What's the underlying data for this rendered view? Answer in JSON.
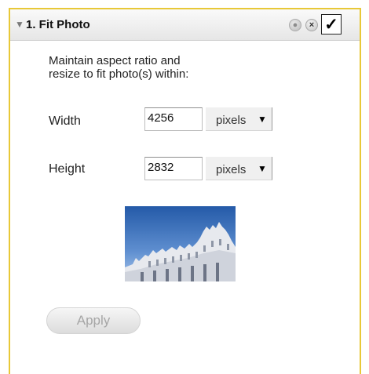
{
  "panel": {
    "disclosure_glyph": "▼",
    "title": "1. Fit Photo",
    "checkbox_mark": "✓"
  },
  "description": {
    "line1": "Maintain aspect ratio and",
    "line2": "resize to fit photo(s) within:"
  },
  "width": {
    "label": "Width",
    "value": "4256",
    "unit": "pixels"
  },
  "height": {
    "label": "Height",
    "value": "2832",
    "unit": "pixels"
  },
  "apply_label": "Apply",
  "colors": {
    "panel_border": "#e8c838",
    "sky_top": "#2a5fb0",
    "sky_bottom": "#8fb3e0"
  },
  "icons": {
    "reset": "reset-icon",
    "close": "close-icon",
    "dropdown": "chevron-down-icon"
  }
}
